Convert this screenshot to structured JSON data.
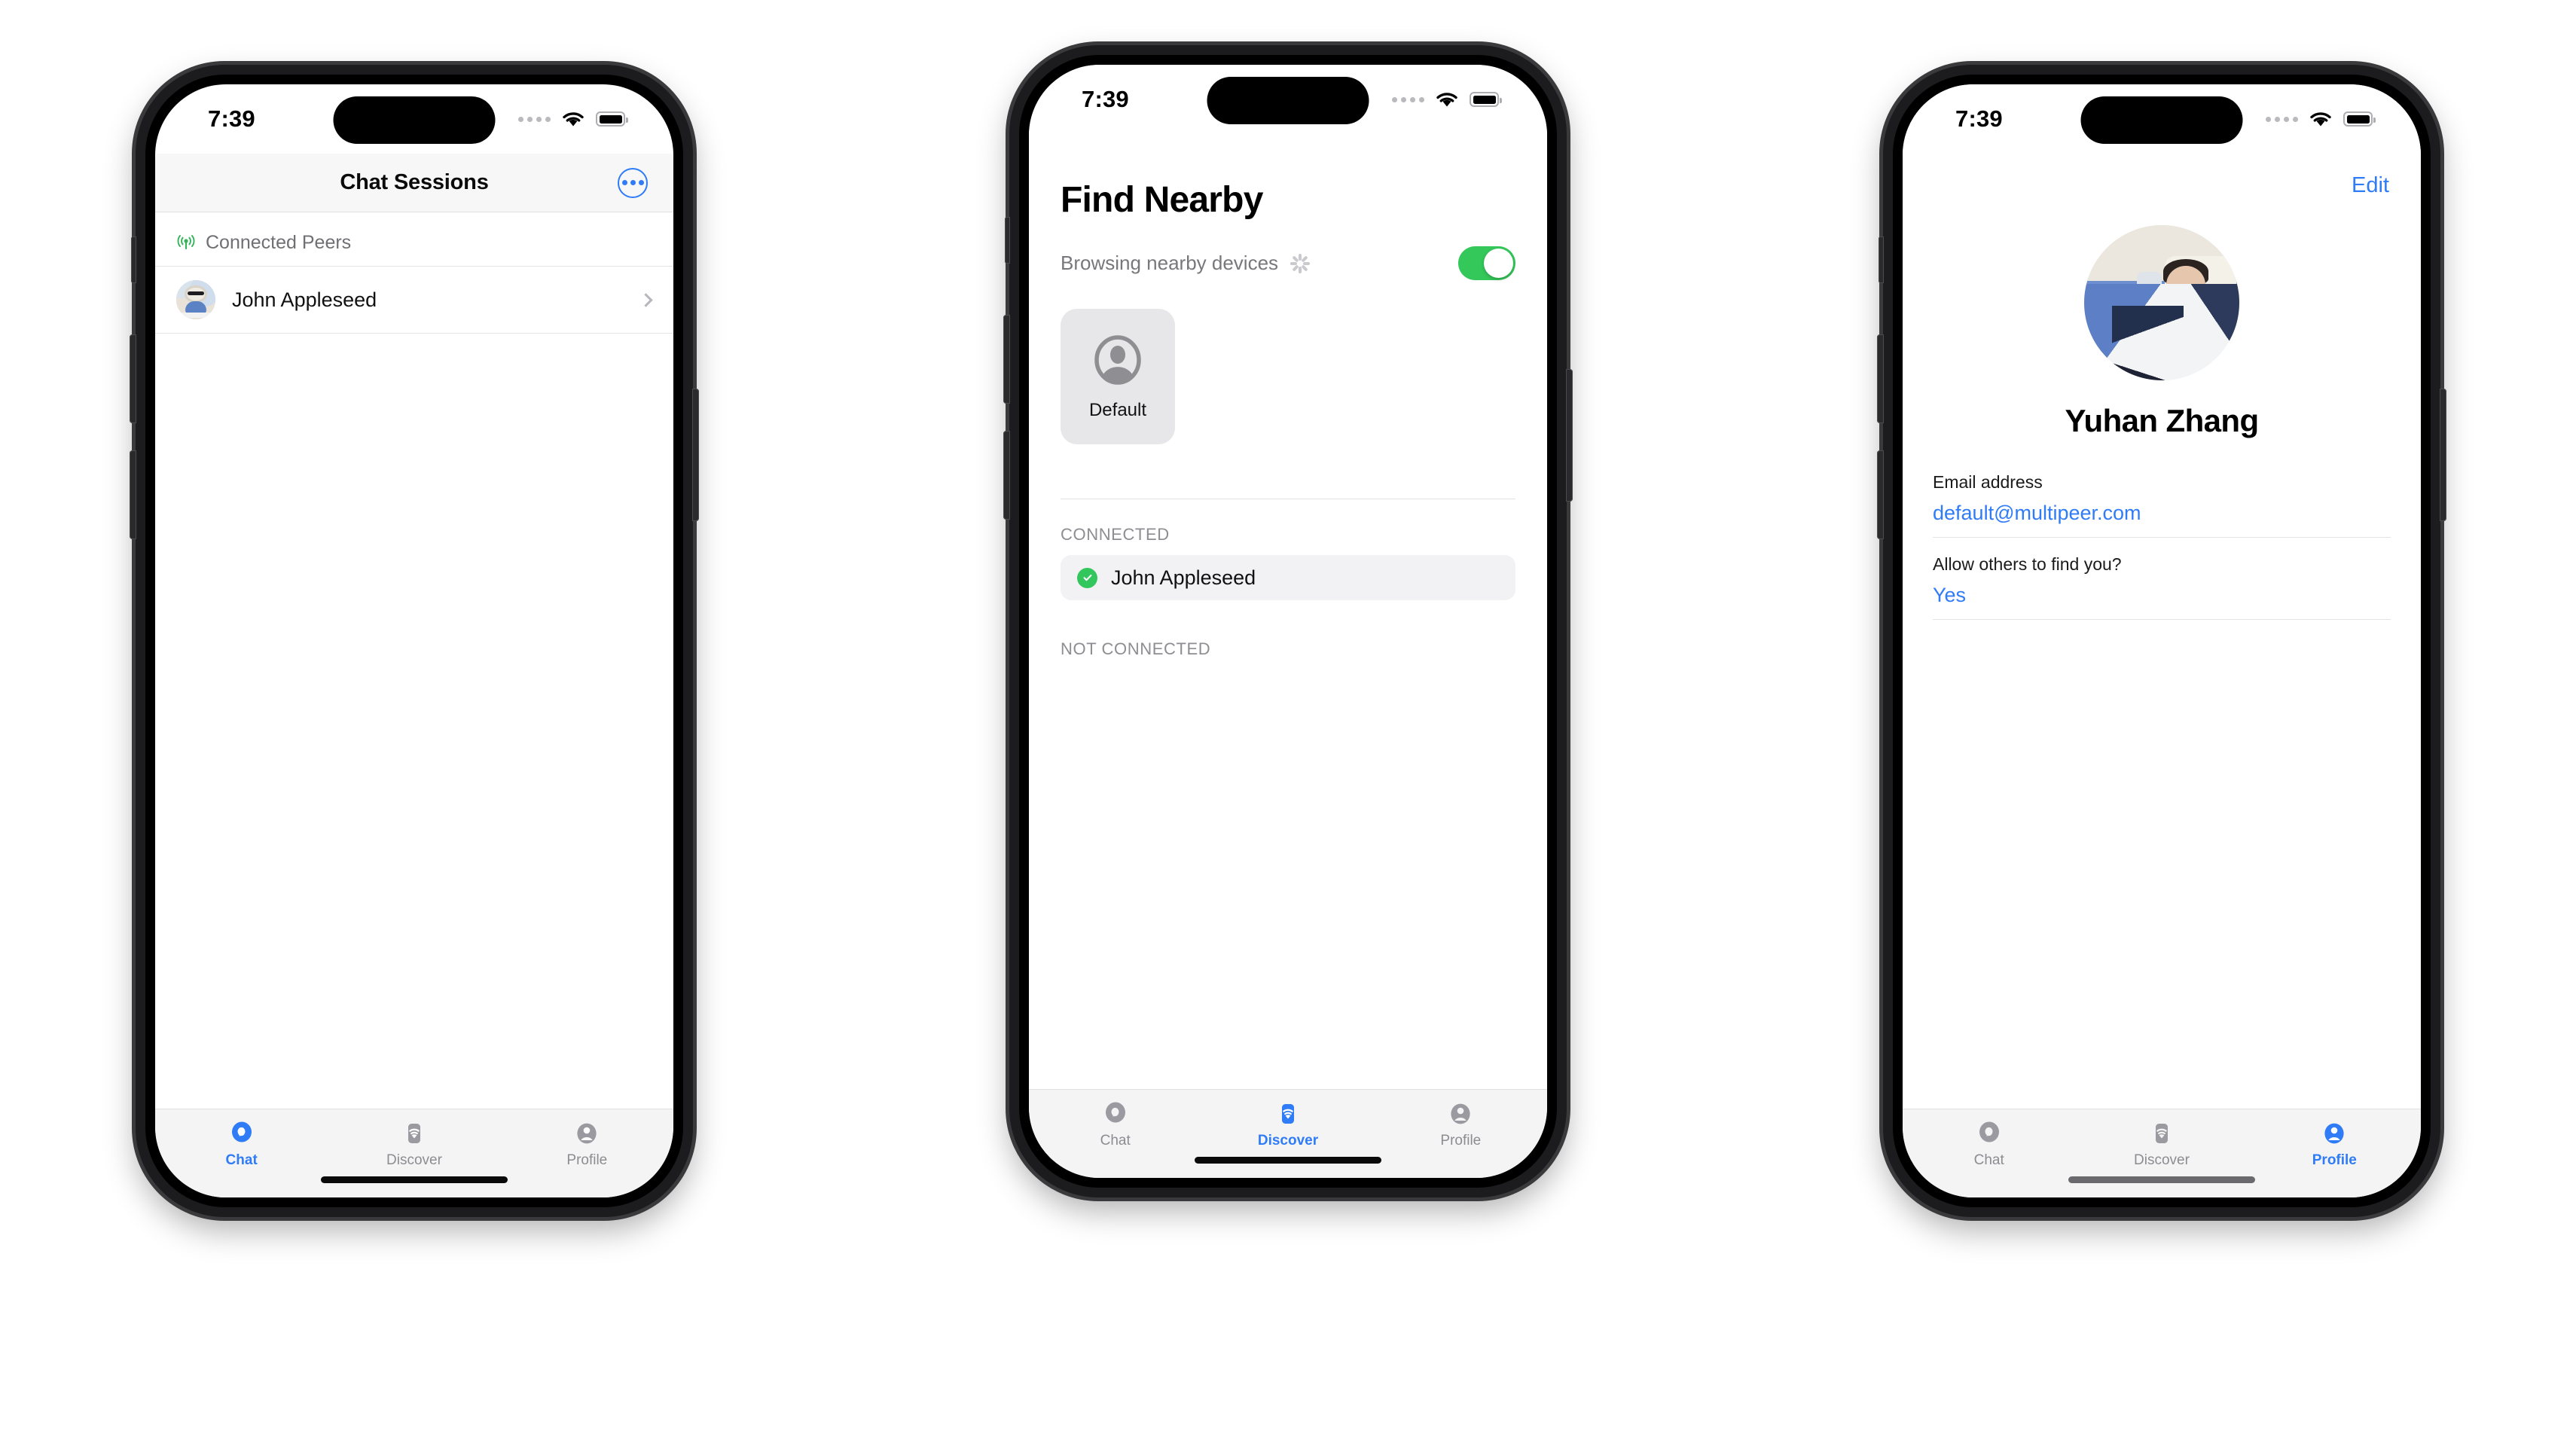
{
  "status_bar": {
    "time": "7:39",
    "wifi_icon": "wifi-icon",
    "battery_icon": "battery-icon",
    "cellular_icon": "cellular-dots-icon"
  },
  "tabs": [
    {
      "label": "Chat",
      "icon": "chat-bubble-icon"
    },
    {
      "label": "Discover",
      "icon": "wifi-card-icon"
    },
    {
      "label": "Profile",
      "icon": "person-circle-icon"
    }
  ],
  "colors": {
    "accent": "#2f7cf6",
    "green": "#34c759",
    "inactive": "#8c8c91"
  },
  "phone1": {
    "nav": {
      "title": "Chat Sessions",
      "more_icon": "ellipsis-circle-icon"
    },
    "section": {
      "label": "Connected Peers",
      "icon": "antenna-broadcast-icon"
    },
    "peers": [
      {
        "name": "John Appleseed",
        "avatar": "dog-plush-avatar",
        "chevron": "chevron-right-icon"
      }
    ],
    "active_tab": "Chat"
  },
  "phone2": {
    "title": "Find Nearby",
    "browsing": {
      "label": "Browsing nearby devices",
      "spinner_icon": "loading-spinner-icon",
      "toggle_on": true
    },
    "devices": [
      {
        "label": "Default",
        "icon": "person-circle-icon"
      }
    ],
    "groups": [
      {
        "title": "CONNECTED",
        "items": [
          {
            "name": "John Appleseed",
            "icon": "check-circle-icon"
          }
        ]
      },
      {
        "title": "NOT CONNECTED",
        "items": []
      }
    ],
    "active_tab": "Discover"
  },
  "phone3": {
    "edit_label": "Edit",
    "avatar": "sleeping-child-photo",
    "name": "Yuhan Zhang",
    "fields": [
      {
        "label": "Email address",
        "value": "default@multipeer.com"
      },
      {
        "label": "Allow others to find you?",
        "value": "Yes"
      }
    ],
    "active_tab": "Profile"
  }
}
